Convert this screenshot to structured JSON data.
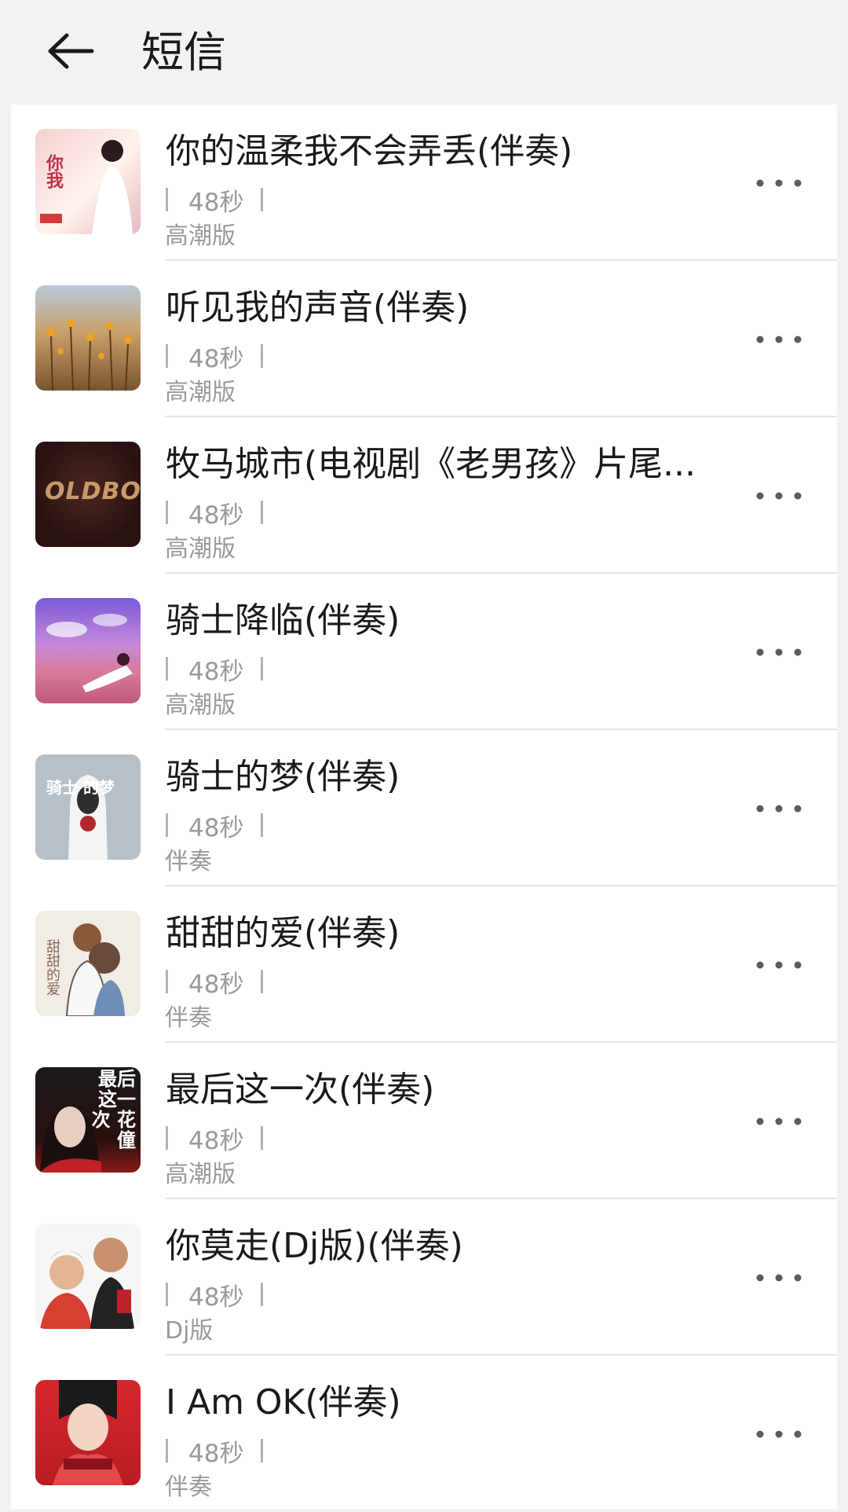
{
  "header": {
    "title": "短信"
  },
  "songs": [
    {
      "title": "你的温柔我不会弄丢(伴奏)",
      "duration": "48秒",
      "version": "高潮版",
      "cover_text": "你我",
      "cover_colors": [
        "#f6d6d6",
        "#e9b4b8",
        "#fff4ec"
      ]
    },
    {
      "title": "听见我的声音(伴奏)",
      "duration": "48秒",
      "version": "高潮版",
      "cover_text": "",
      "cover_colors": [
        "#b7c9dd",
        "#c98a3c",
        "#6b4b2a"
      ]
    },
    {
      "title": "牧马城市(电视剧《老男孩》片尾...",
      "duration": "48秒",
      "version": "高潮版",
      "cover_text": "OLDBOY",
      "cover_colors": [
        "#3a1a1a",
        "#2b1212",
        "#5b2f25"
      ]
    },
    {
      "title": "骑士降临(伴奏)",
      "duration": "48秒",
      "version": "高潮版",
      "cover_text": "",
      "cover_colors": [
        "#8a5bd6",
        "#c46ba8",
        "#e79aa4"
      ]
    },
    {
      "title": "骑士的梦(伴奏)",
      "duration": "48秒",
      "version": "伴奏",
      "cover_text": "骑士 的梦",
      "cover_colors": [
        "#b9c1c8",
        "#9aa4ad",
        "#e8ecef"
      ]
    },
    {
      "title": "甜甜的爱(伴奏)",
      "duration": "48秒",
      "version": "伴奏",
      "cover_text": "甜甜的爱",
      "cover_colors": [
        "#f3ece7",
        "#e5d6cc",
        "#9a7a6c"
      ]
    },
    {
      "title": "最后这一次(伴奏)",
      "duration": "48秒",
      "version": "高潮版",
      "cover_text": "最后 这一次 花僮",
      "cover_colors": [
        "#111111",
        "#5a1010",
        "#d1d1d1"
      ]
    },
    {
      "title": "你莫走(Dj版)(伴奏)",
      "duration": "48秒",
      "version": "Dj版",
      "cover_text": "",
      "cover_colors": [
        "#f4f4f4",
        "#d7a37b",
        "#b7262b"
      ]
    },
    {
      "title": "I Am OK(伴奏)",
      "duration": "48秒",
      "version": "伴奏",
      "cover_text": "",
      "cover_colors": [
        "#c02028",
        "#e24a4a",
        "#f2d6c2"
      ]
    }
  ],
  "icons": {
    "back": "arrow-left-icon",
    "more": "more-horizontal-icon"
  },
  "colors": {
    "header_bg": "#f2f2f2",
    "list_bg": "#ffffff",
    "meta_text": "#9a9a9a",
    "divider": "#e5e5e5"
  }
}
